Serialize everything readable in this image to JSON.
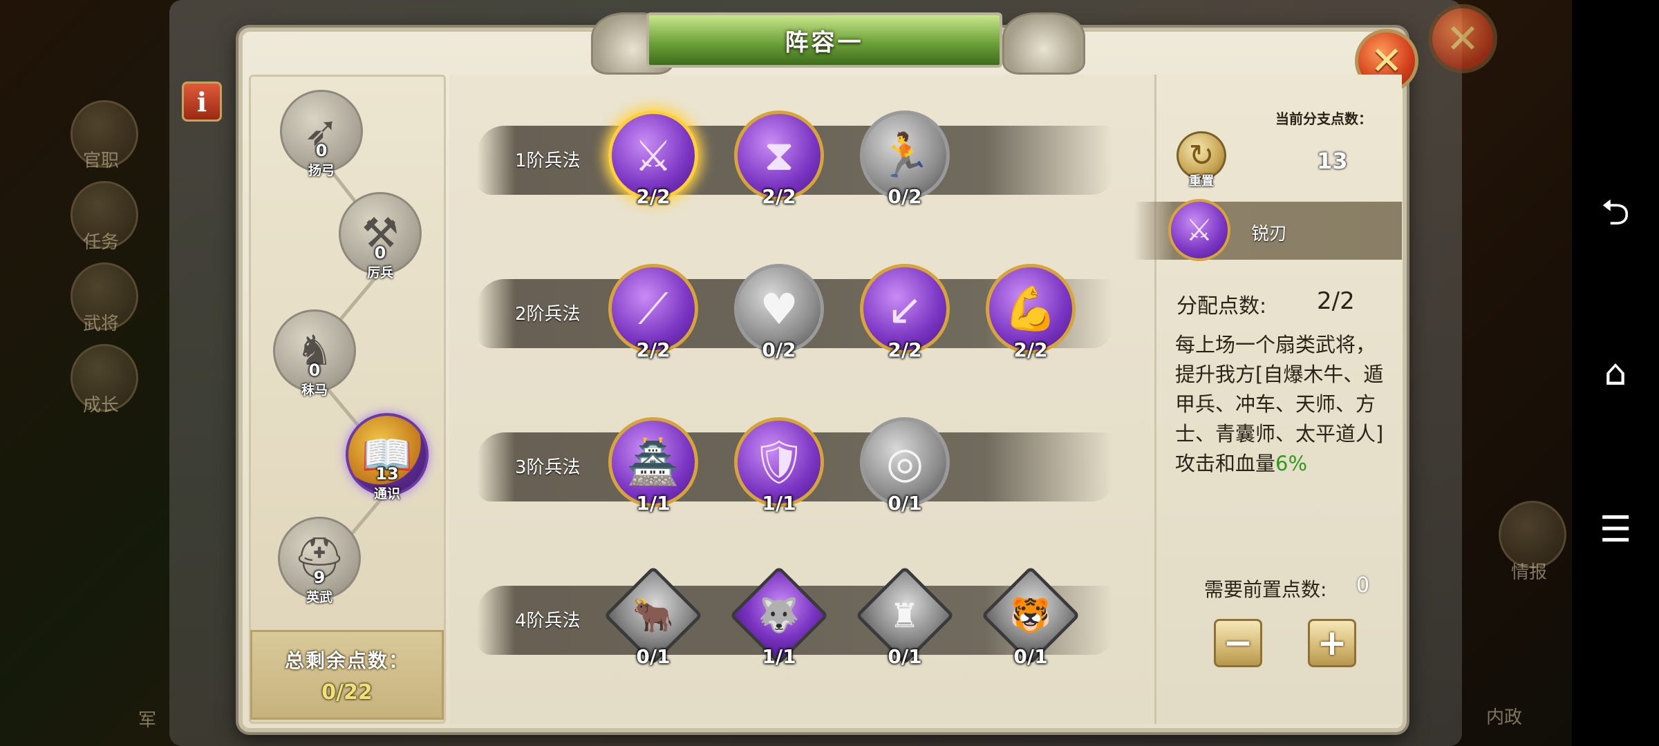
{
  "dialog": {
    "title": "阵容一",
    "close_icon": "close-x-icon",
    "info_icon": "i"
  },
  "tree": {
    "nodes": [
      {
        "name": "扬弓",
        "points": "0",
        "icon": "bow-icon",
        "active": false
      },
      {
        "name": "厉兵",
        "points": "0",
        "icon": "anvil-icon",
        "active": false
      },
      {
        "name": "秣马",
        "points": "0",
        "icon": "horse-icon",
        "active": false
      },
      {
        "name": "通识",
        "points": "13",
        "icon": "book-icon",
        "active": true
      },
      {
        "name": "英武",
        "points": "9",
        "icon": "helmet-icon",
        "active": false
      }
    ],
    "total_label": "总剩余点数：",
    "total_value": "0/22"
  },
  "rows": [
    {
      "label": "1阶兵法",
      "skills": [
        {
          "count": "2/2",
          "icon": "sword-icon",
          "glyph": "⚔",
          "color": "purple",
          "selected": true
        },
        {
          "count": "2/2",
          "icon": "hourglass-icon",
          "glyph": "⧗",
          "color": "purple",
          "selected": false
        },
        {
          "count": "0/2",
          "icon": "running-man-icon",
          "glyph": "🏃",
          "color": "grey",
          "selected": false
        }
      ]
    },
    {
      "label": "2阶兵法",
      "skills": [
        {
          "count": "2/2",
          "icon": "blades-icon",
          "glyph": "⟋",
          "color": "purple",
          "selected": false
        },
        {
          "count": "0/2",
          "icon": "heart-arrow-icon",
          "glyph": "♥",
          "color": "grey",
          "selected": false
        },
        {
          "count": "2/2",
          "icon": "arrow-strike-icon",
          "glyph": "↙",
          "color": "purple",
          "selected": false
        },
        {
          "count": "2/2",
          "icon": "muscle-icon",
          "glyph": "💪",
          "color": "purple",
          "selected": false
        }
      ]
    },
    {
      "label": "3阶兵法",
      "skills": [
        {
          "count": "1/1",
          "icon": "fortress-icon",
          "glyph": "🏯",
          "color": "purple",
          "selected": false
        },
        {
          "count": "1/1",
          "icon": "shield-icon",
          "glyph": "🛡",
          "color": "purple",
          "selected": false
        },
        {
          "count": "0/1",
          "icon": "circle-target-icon",
          "glyph": "◎",
          "color": "grey",
          "selected": false
        }
      ]
    },
    {
      "label": "4阶兵法",
      "skills": [
        {
          "count": "0/1",
          "icon": "ox-icon",
          "glyph": "🐂",
          "color": "grey",
          "selected": false
        },
        {
          "count": "1/1",
          "icon": "wolf-icon",
          "glyph": "🐺",
          "color": "purple",
          "selected": false
        },
        {
          "count": "0/1",
          "icon": "warrior-icon",
          "glyph": "♜",
          "color": "grey",
          "selected": false
        },
        {
          "count": "0/1",
          "icon": "tiger-icon",
          "glyph": "🐯",
          "color": "grey",
          "selected": false
        }
      ]
    }
  ],
  "detail": {
    "branch_points_label": "当前分支点数：",
    "branch_points": "13",
    "reset_label": "重置",
    "selected_name": "锐刃",
    "alloc_label": "分配点数:",
    "alloc_value": "2/2",
    "desc_text": "每上场一个扇类武将，提升我方[自爆木牛、遁甲兵、冲车、天师、方士、青囊师、太平道人]攻击和血量",
    "desc_highlight": "6%",
    "prereq_label": "需要前置点数:",
    "prereq_value": "0",
    "minus_label": "−",
    "plus_label": "+"
  },
  "background": {
    "side_labels": [
      "官职",
      "任务",
      "武将",
      "成长"
    ],
    "right_labels": [
      "情报",
      "内政"
    ],
    "bottom_left_label": "军"
  },
  "navbar": {
    "back_icon": "back-arrow-icon",
    "home_icon": "home-icon",
    "menu_icon": "menu-icon"
  }
}
